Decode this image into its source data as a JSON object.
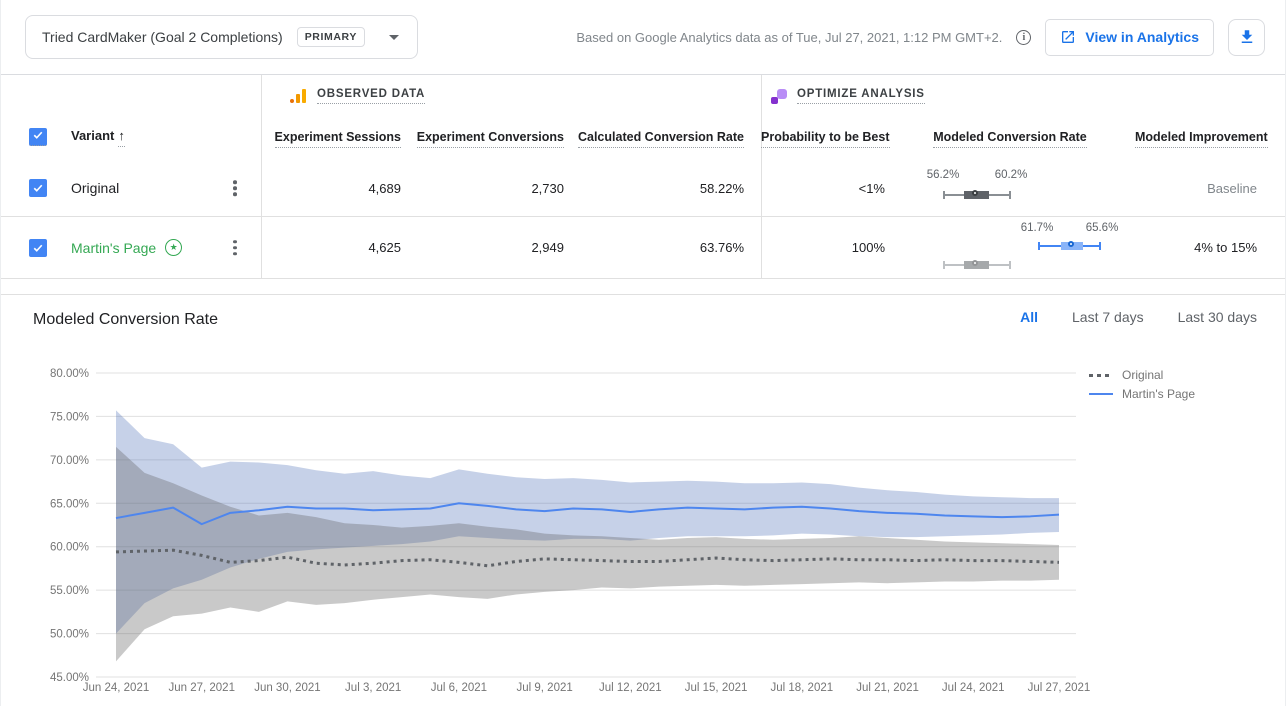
{
  "header": {
    "metric_selector": {
      "label": "Tried CardMaker (Goal 2 Completions)",
      "badge": "PRIMARY"
    },
    "caption": "Based on Google Analytics data as of Tue, Jul 27, 2021, 1:12 PM GMT+2.",
    "info_glyph": "i",
    "view_in_analytics_label": "View in Analytics"
  },
  "table": {
    "sections": {
      "observed": "OBSERVED DATA",
      "optimize": "OPTIMIZE ANALYSIS"
    },
    "variant_header": "Variant",
    "sort_icon": "↑",
    "columns": {
      "sessions": "Experiment Sessions",
      "conversions": "Experiment Conversions",
      "calc_rate": "Calculated Conversion Rate",
      "probability": "Probability to be Best",
      "modeled_rate": "Modeled Conversion Rate",
      "improvement": "Modeled Improvement"
    },
    "rows": [
      {
        "name": "Original",
        "leader": false,
        "sessions": "4,689",
        "conversions": "2,730",
        "calc_rate": "58.22%",
        "probability": "<1%",
        "ci_low": "56.2%",
        "ci_high": "60.2%",
        "improvement": "Baseline"
      },
      {
        "name": "Martin's Page",
        "leader": true,
        "leader_glyph": "★",
        "sessions": "4,625",
        "conversions": "2,949",
        "calc_rate": "63.76%",
        "probability": "100%",
        "ci_low": "61.7%",
        "ci_high": "65.6%",
        "improvement": "4% to 15%"
      }
    ]
  },
  "chart": {
    "title": "Modeled Conversion Rate",
    "tabs": [
      "All",
      "Last 7 days",
      "Last 30 days"
    ],
    "active_tab": "All",
    "legend": [
      "Original",
      "Martin's Page"
    ]
  },
  "colors": {
    "accent_blue": "#1a73e8",
    "checkbox_blue": "#4285f4",
    "leader_green": "#34a853",
    "line_blue": "#4e86ee",
    "line_gray": "#5f6368",
    "band_blue": "rgba(66,103,178,0.30)",
    "band_gray": "rgba(97,97,97,0.34)",
    "ga_orange": "#f9ab00",
    "optimize_purple": "#8430ce"
  },
  "chart_data": {
    "type": "line",
    "title": "Modeled Conversion Rate",
    "xlabel": "",
    "ylabel": "",
    "ylim": [
      45,
      80
    ],
    "yticks": [
      45,
      50,
      55,
      60,
      65,
      70,
      75,
      80
    ],
    "grid": true,
    "legend_position": "top-right",
    "n_points": 34,
    "x_tick_every": 3,
    "x_tick_labels": [
      "Jun 24, 2021",
      "Jun 27, 2021",
      "Jun 30, 2021",
      "Jul 3, 2021",
      "Jul 6, 2021",
      "Jul 9, 2021",
      "Jul 12, 2021",
      "Jul 15, 2021",
      "Jul 18, 2021",
      "Jul 21, 2021",
      "Jul 24, 2021",
      "Jul 27, 2021"
    ],
    "series": [
      {
        "name": "Original",
        "style": "dotted",
        "color": "#5f6368",
        "values": [
          59.4,
          59.5,
          59.6,
          59.0,
          58.2,
          58.4,
          58.8,
          58.1,
          57.9,
          58.1,
          58.4,
          58.5,
          58.2,
          57.8,
          58.3,
          58.6,
          58.5,
          58.4,
          58.3,
          58.3,
          58.5,
          58.7,
          58.5,
          58.4,
          58.5,
          58.6,
          58.5,
          58.5,
          58.4,
          58.5,
          58.4,
          58.4,
          58.3,
          58.2
        ]
      },
      {
        "name": "Martin's Page",
        "style": "solid",
        "color": "#4e86ee",
        "values": [
          63.3,
          63.9,
          64.5,
          62.6,
          63.9,
          64.2,
          64.6,
          64.4,
          64.4,
          64.2,
          64.3,
          64.4,
          65.0,
          64.7,
          64.3,
          64.1,
          64.4,
          64.3,
          64.0,
          64.3,
          64.5,
          64.4,
          64.3,
          64.5,
          64.6,
          64.4,
          64.1,
          63.9,
          63.8,
          63.6,
          63.5,
          63.4,
          63.5,
          63.7
        ]
      }
    ],
    "bands": [
      {
        "name": "Martin's Page 95% CI",
        "color": "rgba(66,103,178,0.30)",
        "upper": [
          75.7,
          72.5,
          71.8,
          69.1,
          69.8,
          69.7,
          69.4,
          68.8,
          68.4,
          68.7,
          68.2,
          67.9,
          68.9,
          68.4,
          68.0,
          67.8,
          67.9,
          67.7,
          67.4,
          67.5,
          67.6,
          67.5,
          67.3,
          67.3,
          67.4,
          67.2,
          66.8,
          66.5,
          66.3,
          66.0,
          65.8,
          65.7,
          65.6,
          65.6
        ],
        "lower": [
          50.0,
          53.5,
          55.2,
          56.2,
          57.6,
          58.6,
          59.4,
          59.7,
          59.9,
          60.1,
          60.3,
          60.6,
          61.2,
          61.0,
          60.8,
          60.7,
          60.9,
          60.9,
          60.7,
          61.0,
          61.2,
          61.2,
          61.2,
          61.3,
          61.5,
          61.4,
          61.2,
          61.1,
          61.1,
          61.2,
          61.3,
          61.4,
          61.6,
          61.7
        ]
      },
      {
        "name": "Original 95% CI",
        "color": "rgba(97,97,97,0.34)",
        "upper": [
          71.5,
          68.5,
          67.3,
          65.9,
          64.6,
          63.6,
          63.9,
          63.4,
          62.7,
          62.5,
          62.2,
          62.4,
          62.7,
          62.3,
          62.0,
          61.5,
          61.3,
          61.2,
          61.0,
          60.8,
          61.0,
          61.1,
          60.9,
          60.8,
          60.9,
          61.0,
          61.2,
          61.0,
          60.8,
          60.6,
          60.5,
          60.4,
          60.3,
          60.2
        ],
        "lower": [
          46.8,
          50.5,
          52.0,
          52.3,
          53.0,
          52.5,
          53.7,
          53.3,
          53.5,
          53.9,
          54.2,
          54.5,
          54.2,
          54.0,
          54.5,
          54.8,
          55.0,
          55.3,
          55.2,
          55.4,
          55.5,
          55.6,
          55.5,
          55.6,
          55.7,
          55.8,
          55.9,
          55.8,
          55.9,
          56.0,
          56.0,
          56.1,
          56.1,
          56.2
        ]
      }
    ]
  }
}
